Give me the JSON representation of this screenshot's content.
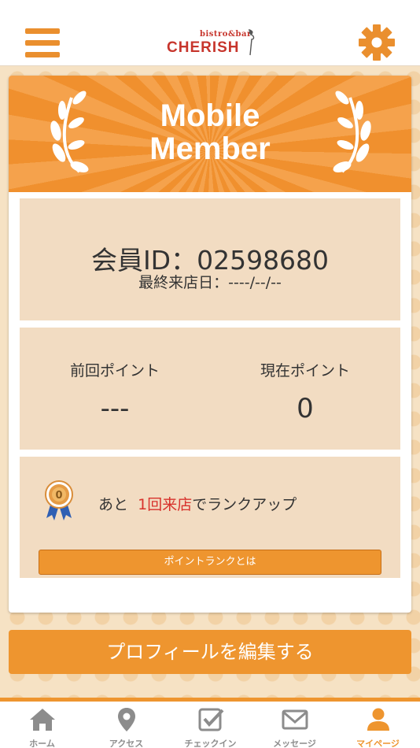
{
  "header": {
    "logo_small": "bistro&bar",
    "logo_main": "CHERISH",
    "menu_icon": "hamburger-menu-icon",
    "settings_icon": "gear-icon"
  },
  "banner": {
    "title_line1": "Mobile",
    "title_line2": "Member"
  },
  "member": {
    "id_text": "会員ID：02598680",
    "last_visit": "最終来店日：----/--/--"
  },
  "points": {
    "previous_label": "前回ポイント",
    "previous_value": "---",
    "current_label": "現在ポイント",
    "current_value": "0"
  },
  "rank": {
    "prefix": "あと",
    "highlight": "1回来店",
    "suffix": "でランクアップ",
    "medal_number": "0",
    "button_label": "ポイントランクとは"
  },
  "profile_button": "プロフィールを編集する",
  "tabs": [
    {
      "label": "ホーム",
      "icon": "home-icon",
      "active": false
    },
    {
      "label": "アクセス",
      "icon": "map-pin-icon",
      "active": false
    },
    {
      "label": "チェックイン",
      "icon": "checkin-icon",
      "active": false
    },
    {
      "label": "メッセージ",
      "icon": "mail-icon",
      "active": false
    },
    {
      "label": "マイページ",
      "icon": "user-icon",
      "active": true
    }
  ],
  "colors": {
    "accent": "#ee952f",
    "highlight": "#d8322c",
    "panel": "#f2dcc2",
    "tab_inactive": "#8c8c8c"
  }
}
